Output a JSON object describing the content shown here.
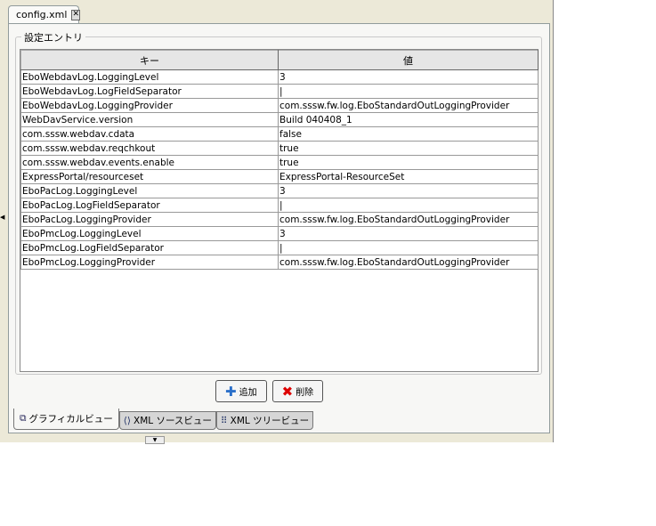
{
  "file_tab": {
    "label": "config.xml"
  },
  "group_title": "設定エントリ",
  "table": {
    "columns": [
      "キー",
      "値"
    ],
    "rows": [
      [
        "EboWebdavLog.LoggingLevel",
        "3"
      ],
      [
        "EboWebdavLog.LogFieldSeparator",
        "|"
      ],
      [
        "EboWebdavLog.LoggingProvider",
        "com.sssw.fw.log.EboStandardOutLoggingProvider"
      ],
      [
        "WebDavService.version",
        "Build 040408_1"
      ],
      [
        "com.sssw.webdav.cdata",
        "false"
      ],
      [
        "com.sssw.webdav.reqchkout",
        "true"
      ],
      [
        "com.sssw.webdav.events.enable",
        "true"
      ],
      [
        "ExpressPortal/resourceset",
        "ExpressPortal-ResourceSet"
      ],
      [
        "EboPacLog.LoggingLevel",
        "3"
      ],
      [
        "EboPacLog.LogFieldSeparator",
        "|"
      ],
      [
        "EboPacLog.LoggingProvider",
        "com.sssw.fw.log.EboStandardOutLoggingProvider"
      ],
      [
        "EboPmcLog.LoggingLevel",
        "3"
      ],
      [
        "EboPmcLog.LogFieldSeparator",
        "|"
      ],
      [
        "EboPmcLog.LoggingProvider",
        "com.sssw.fw.log.EboStandardOutLoggingProvider"
      ]
    ]
  },
  "buttons": {
    "add": "追加",
    "delete": "削除"
  },
  "view_tabs": [
    "グラフィカルビュー",
    "XML ソースビュー",
    "XML ツリービュー"
  ]
}
